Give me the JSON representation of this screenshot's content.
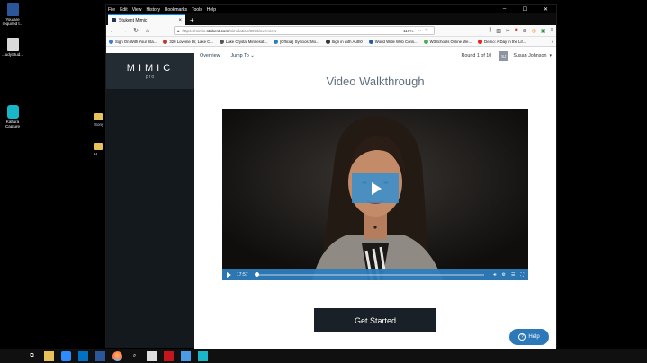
{
  "desktop": {
    "icons": [
      {
        "name": "word-file",
        "label": "You are required t...",
        "color": "#2b579a"
      },
      {
        "name": "study-file",
        "label": "...udyStud...",
        "color": "#d0d0d0"
      },
      {
        "name": "kaltura-capture",
        "label": "Kaltura Capture",
        "color": "#19b5c9"
      }
    ],
    "peek_labels": [
      "Sony",
      "H"
    ]
  },
  "browser": {
    "menu": [
      "File",
      "Edit",
      "View",
      "History",
      "Bookmarks",
      "Tools",
      "Help"
    ],
    "tab_title": "Stukent Mimic",
    "tab_close": "×",
    "new_tab": "+",
    "url_prefix": "https://mimic.",
    "url_host": "stukent.com",
    "url_path": "/simulation/8976/overview",
    "zoom": "110%",
    "bookmarks": [
      {
        "label": "Sign On With Your Sta...",
        "color": "#3a7bd5"
      },
      {
        "label": "320 Loveine Dr, Lake C...",
        "color": "#c0392b"
      },
      {
        "label": "Lake Crystal Minnesot...",
        "color": "#555555"
      },
      {
        "label": "[Official] Syncios: Mo...",
        "color": "#2980b9"
      },
      {
        "label": "Sign in with Auth0",
        "color": "#333333"
      },
      {
        "label": "World Wide Web Cons...",
        "color": "#1e5aa8"
      },
      {
        "label": "W3Schools Online We...",
        "color": "#4caf50"
      },
      {
        "label": "Demo: A Day in the Lif...",
        "color": "#e62117"
      }
    ]
  },
  "app": {
    "brand": "MIMIC",
    "brand_sub": "pro",
    "nav_overview": "Overview",
    "nav_jump": "Jump To",
    "round": "Round 1 of 10",
    "avatar": "SJ",
    "user": "Susan Johnson",
    "heading": "Video Walkthrough",
    "video_time": "17:57",
    "progress": 0.0,
    "cta": "Get Started",
    "help": "Help"
  }
}
